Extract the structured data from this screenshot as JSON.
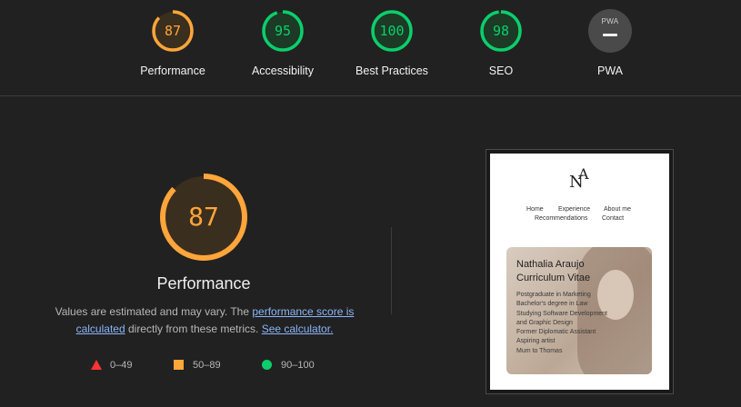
{
  "categories": [
    {
      "label": "Performance",
      "score": "87",
      "value": 87,
      "color": "#ffa53a",
      "bg": "#3a2e1e"
    },
    {
      "label": "Accessibility",
      "score": "95",
      "value": 95,
      "color": "#0cce6b",
      "bg": "#1c3a26"
    },
    {
      "label": "Best Practices",
      "score": "100",
      "value": 100,
      "color": "#0cce6b",
      "bg": "#1c3a26"
    },
    {
      "label": "SEO",
      "score": "98",
      "value": 98,
      "color": "#0cce6b",
      "bg": "#1c3a26"
    },
    {
      "label": "PWA",
      "badge": "PWA"
    }
  ],
  "main_gauge": {
    "score": "87",
    "value": 87,
    "title": "Performance",
    "color": "#ffa53a"
  },
  "description": {
    "text1": "Values are estimated and may vary. The ",
    "link1": "performance score is calculated",
    "text2": " directly from these metrics. ",
    "link2": "See calculator."
  },
  "legend": [
    {
      "shape": "triangle",
      "range": "0–49",
      "color": "#ff3333"
    },
    {
      "shape": "square",
      "range": "50–89",
      "color": "#ffa53a"
    },
    {
      "shape": "circle",
      "range": "90–100",
      "color": "#0cce6b"
    }
  ],
  "preview": {
    "logo_n": "N",
    "logo_a": "A",
    "nav": [
      "Home",
      "Experience",
      "About me",
      "Recommendations",
      "Contact"
    ],
    "card_title": [
      "Nathalia Araujo",
      "Curriculum Vitae"
    ],
    "card_lines": [
      "Postgraduate in Marketing",
      "Bachelor's degree in Law",
      "Studying Software Development",
      "and Graphic Design",
      "Former Diplomatic Assistant",
      "Aspiring artist",
      "Mum to Thomas"
    ]
  }
}
